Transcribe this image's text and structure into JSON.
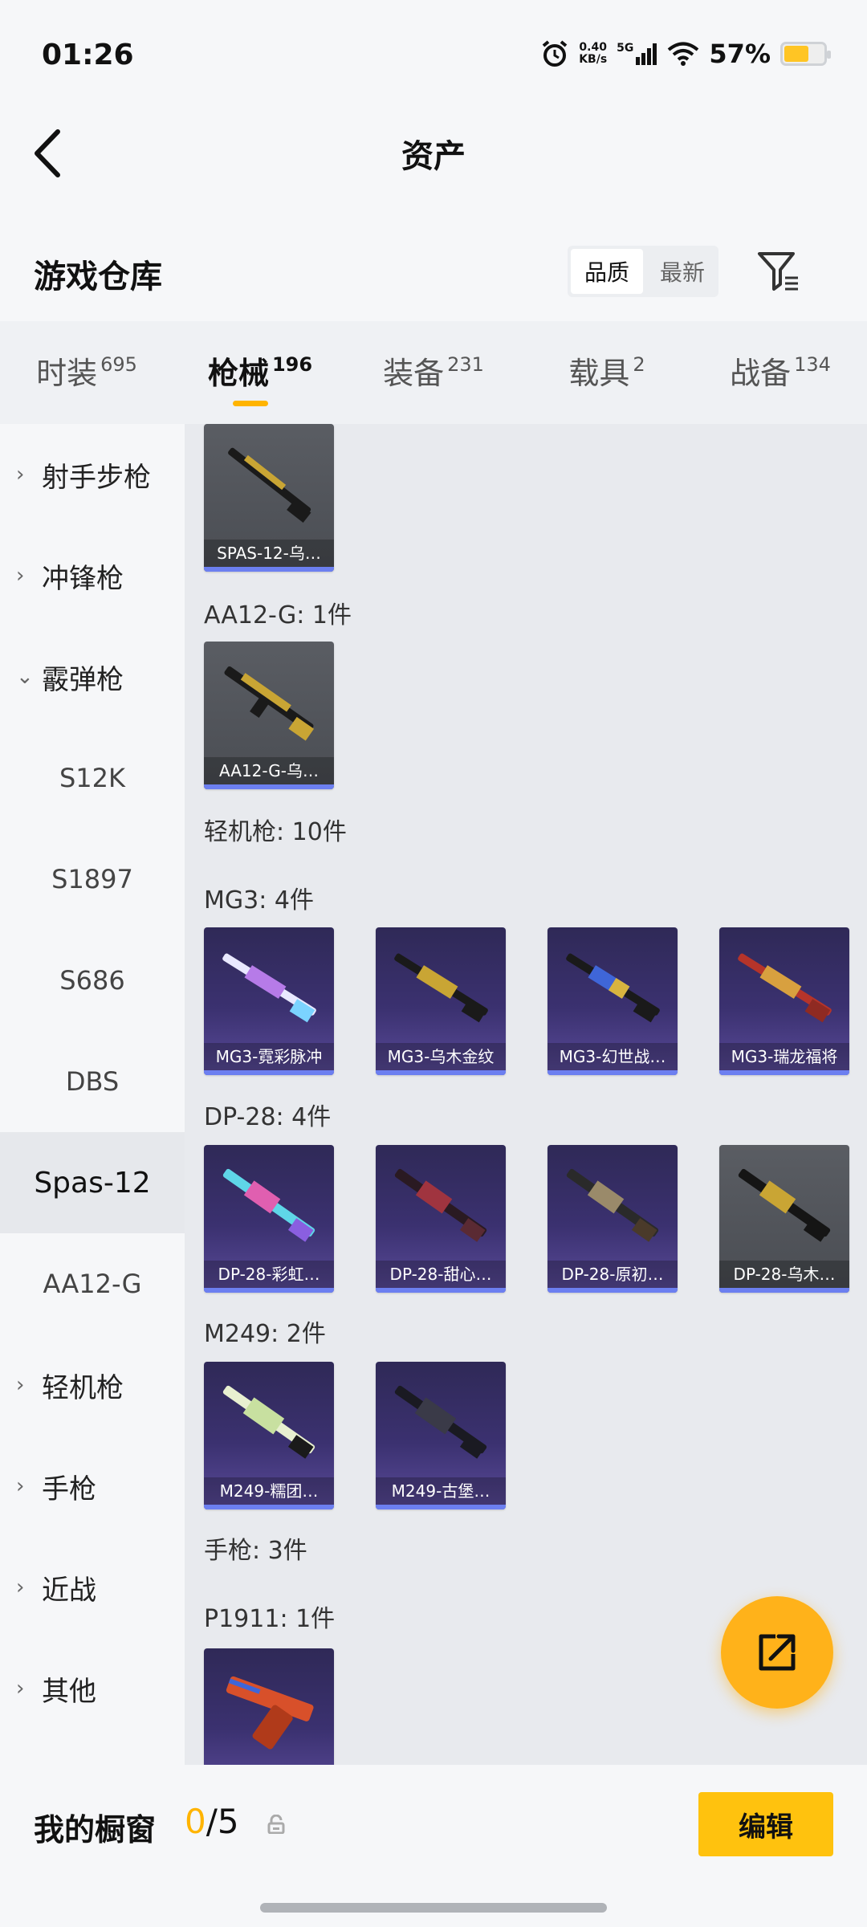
{
  "status_bar": {
    "time": "01:26",
    "net_speed_value": "0.40",
    "net_speed_unit": "KB/s",
    "network_type": "5G",
    "battery_percent": "57%",
    "battery_level": 0.57
  },
  "nav": {
    "title": "资产"
  },
  "warehouse": {
    "title": "游戏仓库",
    "sort_options": [
      "品质",
      "最新"
    ],
    "sort_selected": "品质"
  },
  "tabs": [
    {
      "label": "时装",
      "count": "695"
    },
    {
      "label": "枪械",
      "count": "196",
      "active": true
    },
    {
      "label": "装备",
      "count": "231"
    },
    {
      "label": "载具",
      "count": "2"
    },
    {
      "label": "战备",
      "count": "134"
    }
  ],
  "sidebar": {
    "items": [
      {
        "label": "射手步枪",
        "type": "category",
        "expanded": false
      },
      {
        "label": "冲锋枪",
        "type": "category",
        "expanded": false
      },
      {
        "label": "霰弹枪",
        "type": "category",
        "expanded": true
      },
      {
        "label": "S12K",
        "type": "sub"
      },
      {
        "label": "S1897",
        "type": "sub"
      },
      {
        "label": "S686",
        "type": "sub"
      },
      {
        "label": "DBS",
        "type": "sub"
      },
      {
        "label": "Spas-12",
        "type": "sub",
        "selected": true
      },
      {
        "label": "AA12-G",
        "type": "sub"
      },
      {
        "label": "轻机枪",
        "type": "category",
        "expanded": false
      },
      {
        "label": "手枪",
        "type": "category",
        "expanded": false
      },
      {
        "label": "近战",
        "type": "category",
        "expanded": false
      },
      {
        "label": "其他",
        "type": "category",
        "expanded": false
      }
    ]
  },
  "content": {
    "spas_card": {
      "caption": "SPAS-12-乌…"
    },
    "aa12_title": "AA12-G: 1件",
    "aa12_card": {
      "caption": "AA12-G-乌…"
    },
    "lmg_title": "轻机枪: 10件",
    "mg3_title": "MG3: 4件",
    "mg3_cards": [
      "MG3-霓彩脉冲",
      "MG3-乌木金纹",
      "MG3-幻世战…",
      "MG3-瑞龙福将"
    ],
    "dp28_title": "DP-28: 4件",
    "dp28_cards": [
      "DP-28-彩虹…",
      "DP-28-甜心…",
      "DP-28-原初…",
      "DP-28-乌木…"
    ],
    "m249_title": "M249: 2件",
    "m249_cards": [
      "M249-糯团…",
      "M249-古堡…"
    ],
    "pistol_title": "手枪: 3件",
    "p1911_title": "P1911: 1件"
  },
  "bottom": {
    "label": "我的橱窗",
    "count_current": "0",
    "count_separator": "/",
    "count_total": "5",
    "edit_label": "编辑"
  },
  "colors": {
    "accent": "#ffb400",
    "button": "#ffc20e",
    "card_purple": "#3b3170",
    "card_grey": "#55585e",
    "rarity_bar": "#6c7ff0"
  },
  "icons": [
    "back-arrow-icon",
    "filter-icon",
    "share-icon",
    "lock-icon",
    "chevron-right-icon",
    "chevron-down-icon",
    "alarm-icon",
    "signal-icon",
    "wifi-icon",
    "battery-icon"
  ]
}
